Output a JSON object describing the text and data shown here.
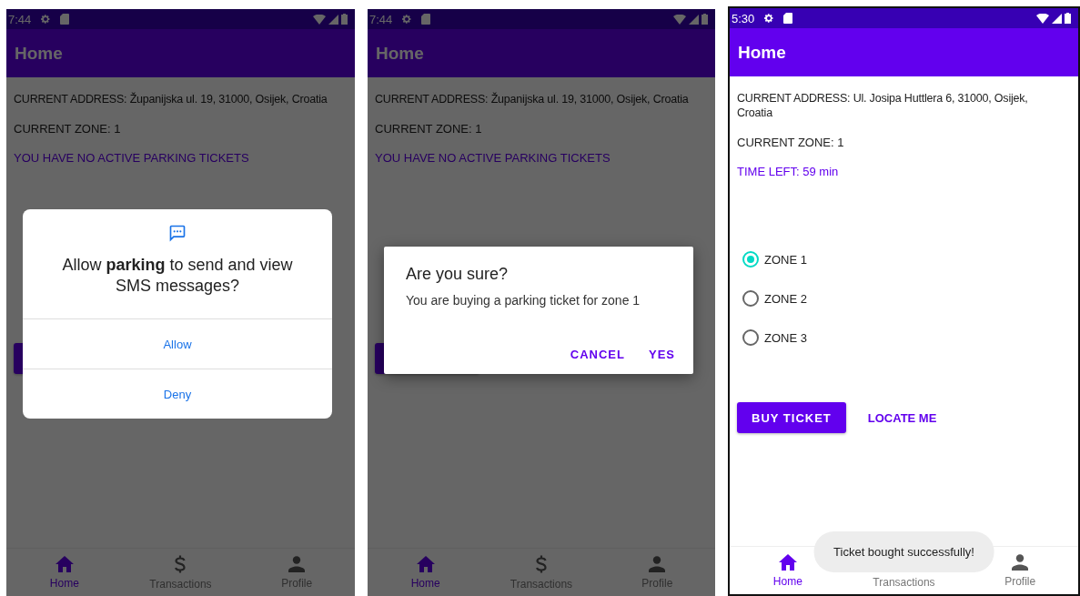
{
  "screens": [
    {
      "status_bar": {
        "time": "7:44"
      },
      "app_bar": {
        "title": "Home"
      },
      "dimmed": true,
      "address": "CURRENT ADDRESS: Županijska ul. 19, 31000, Osijek, Croatia",
      "zone": "CURRENT ZONE: 1",
      "ticket_status": "YOU HAVE NO ACTIVE PARKING TICKETS",
      "buttons": [
        {
          "kind": "filled"
        }
      ],
      "dialog": {
        "kind": "permission",
        "message": "Allow **parking** to send and view SMS messages?",
        "actions": [
          "Allow",
          "Deny"
        ]
      },
      "nav": [
        {
          "label": "Home",
          "selected": true
        },
        {
          "label": "Transactions",
          "selected": false
        },
        {
          "label": "Profile",
          "selected": false
        }
      ]
    },
    {
      "status_bar": {
        "time": "7:44"
      },
      "app_bar": {
        "title": "Home"
      },
      "dimmed": true,
      "address": "CURRENT ADDRESS: Županijska ul. 19, 31000, Osijek, Croatia",
      "zone": "CURRENT ZONE: 1",
      "ticket_status": "YOU HAVE NO ACTIVE PARKING TICKETS",
      "buttons": [
        {
          "kind": "filled"
        }
      ],
      "dialog": {
        "kind": "alert",
        "title": "Are you sure?",
        "message": "You are buying a parking ticket for zone 1",
        "actions": [
          "CANCEL",
          "YES"
        ]
      },
      "nav": [
        {
          "label": "Home",
          "selected": true
        },
        {
          "label": "Transactions",
          "selected": false
        },
        {
          "label": "Profile",
          "selected": false
        }
      ]
    },
    {
      "status_bar": {
        "time": "5:30"
      },
      "app_bar": {
        "title": "Home"
      },
      "address": "CURRENT ADDRESS: Ul. Josipa Huttlera 6, 31000, Osijek, Croatia",
      "zone": "CURRENT ZONE: 1",
      "ticket_status": "TIME LEFT: 59 min",
      "zones": [
        {
          "label": "ZONE 1",
          "selected": true
        },
        {
          "label": "ZONE 2",
          "selected": false
        },
        {
          "label": "ZONE 3",
          "selected": false
        }
      ],
      "buttons": [
        {
          "kind": "filled",
          "label": "BUY TICKET"
        },
        {
          "kind": "text",
          "label": "LOCATE ME"
        }
      ],
      "toast": "Ticket bought successfully!",
      "nav": [
        {
          "label": "Home",
          "selected": true
        },
        {
          "label": "Transactions",
          "selected": false
        },
        {
          "label": "Profile",
          "selected": false
        }
      ]
    }
  ]
}
